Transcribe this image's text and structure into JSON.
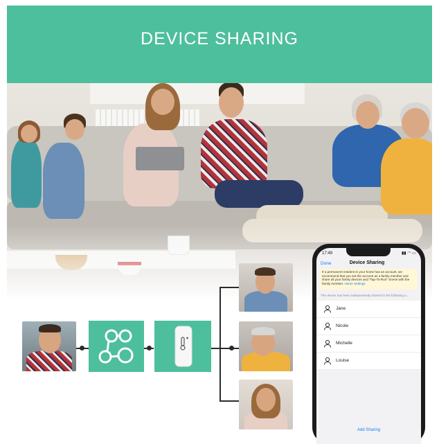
{
  "header": {
    "title": "DEVICE SHARING"
  },
  "diagram": {
    "hub_icon": "share-nodes-icon",
    "device_icon": "thermometer-sensor-icon"
  },
  "phone": {
    "status_time": "17:49",
    "status_icons": "▮▮ ◠ ▭",
    "nav_done": "Done",
    "nav_title": "Device Sharing",
    "notice_text": "If a permanent resident in your home has an account, we recommend that you set the account as a family member and share all your family devices and \"Tap-To-Run\" Scene with the family member.",
    "notice_link": "Home Settings",
    "shared_note": "The device has been independently shared to the following u...",
    "members": [
      {
        "name": "Jane"
      },
      {
        "name": "Nicole"
      },
      {
        "name": "Michelle"
      },
      {
        "name": "Louise"
      }
    ],
    "add_sharing": "Add Sharing"
  },
  "colors": {
    "accent": "#4dbf9c",
    "link": "#1a7cf5",
    "notice_bg": "#fff7d6"
  }
}
